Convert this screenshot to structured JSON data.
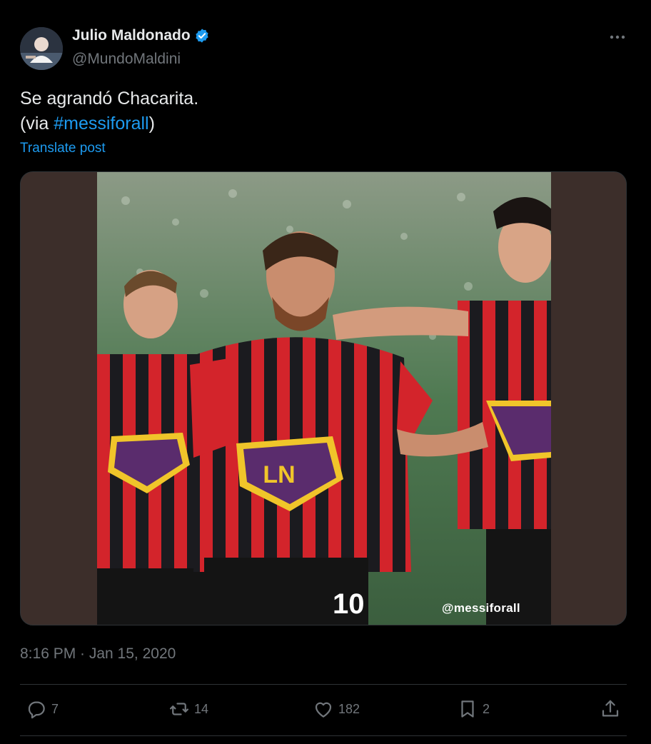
{
  "author": {
    "name": "Julio Maldonado",
    "handle": "@MundoMaldini",
    "verified": true
  },
  "post": {
    "text_line1": "Se agrandó Chacarita.",
    "text_line2_prefix": "(via ",
    "hashtag": "#messiforall",
    "text_line2_suffix": ")",
    "translate_label": "Translate post",
    "media_watermark": "@messiforall",
    "timestamp": "8:16 PM · Jan 15, 2020"
  },
  "actions": {
    "replies": "7",
    "reposts": "14",
    "likes": "182",
    "bookmarks": "2"
  },
  "icons": {
    "reply": "reply-icon",
    "repost": "repost-icon",
    "like": "heart-icon",
    "bookmark": "bookmark-icon",
    "share": "share-icon",
    "more": "more-icon",
    "verified": "verified-badge-icon"
  },
  "colors": {
    "background": "#000000",
    "text": "#e7e9ea",
    "muted": "#71767b",
    "accent": "#1d9bf0",
    "divider": "#2f3336"
  }
}
